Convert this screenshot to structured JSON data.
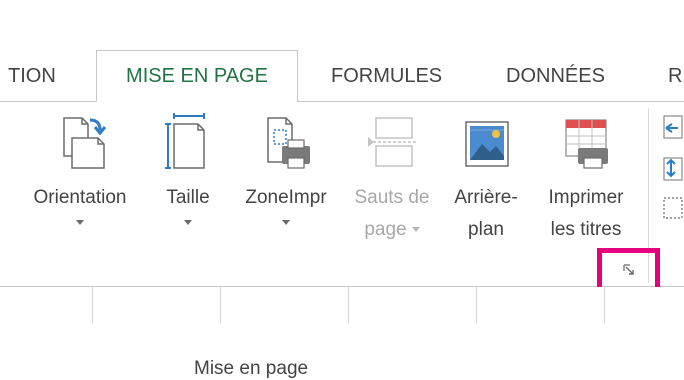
{
  "tabs": [
    {
      "label": "TION",
      "active": false
    },
    {
      "label": "MISE EN PAGE",
      "active": true
    },
    {
      "label": "FORMULES",
      "active": false
    },
    {
      "label": "DONNÉES",
      "active": false
    },
    {
      "label": "R",
      "active": false
    }
  ],
  "group": {
    "label": "Mise en page",
    "buttons": [
      {
        "label": "Orientation",
        "icon": "orientation-icon",
        "has_dropdown": true,
        "enabled": true
      },
      {
        "label": "Taille",
        "icon": "page-size-icon",
        "has_dropdown": true,
        "enabled": true
      },
      {
        "label": "ZoneImpr",
        "icon": "print-area-icon",
        "has_dropdown": true,
        "enabled": true
      },
      {
        "label_line1": "Sauts de",
        "label_line2": "page",
        "icon": "page-breaks-icon",
        "has_dropdown": true,
        "enabled": false
      },
      {
        "label_line1": "Arrière-",
        "label_line2": "plan",
        "icon": "background-icon",
        "has_dropdown": false,
        "enabled": true
      },
      {
        "label_line1": "Imprimer",
        "label_line2": "les titres",
        "icon": "print-titles-icon",
        "has_dropdown": false,
        "enabled": true
      }
    ]
  },
  "colors": {
    "accent": "#217346",
    "highlight": "#e6007e",
    "text": "#444444",
    "disabled_text": "#a8a8a8"
  }
}
